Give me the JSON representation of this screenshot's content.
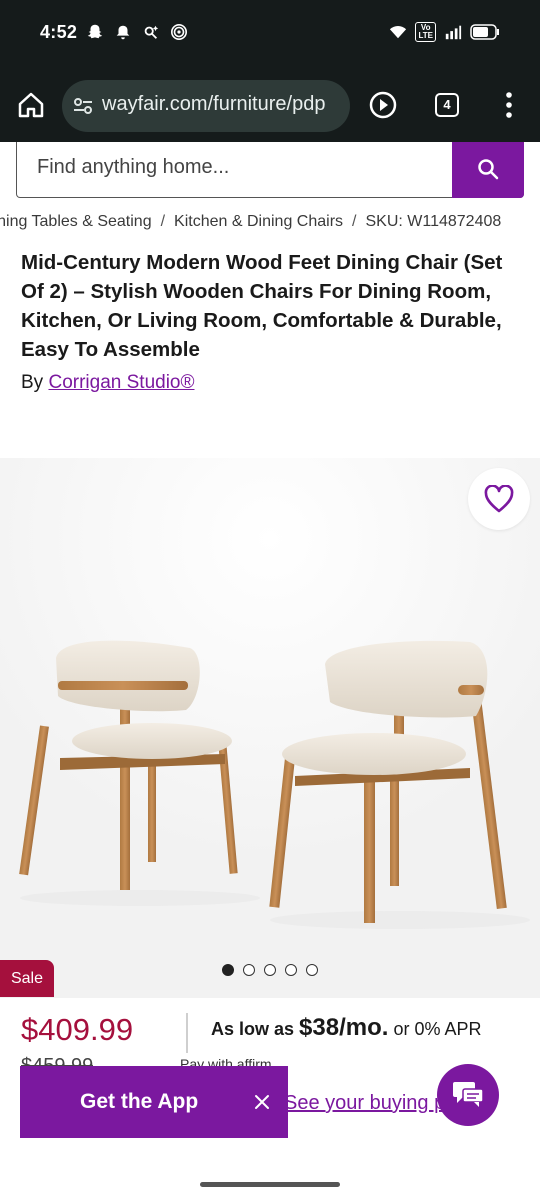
{
  "status_bar": {
    "time": "4:52",
    "network_badge_top": "Vo",
    "network_badge_bottom": "LTE",
    "icons": [
      "snapchat-icon",
      "bell-icon",
      "assistant-icon",
      "hotspot-icon",
      "wifi-icon",
      "signal-icon",
      "battery-icon"
    ]
  },
  "browser": {
    "url": "wayfair.com/furniture/pdp",
    "tab_count": "4"
  },
  "search": {
    "placeholder": "Find anything home..."
  },
  "breadcrumb": {
    "items": [
      "Dining Tables & Seating",
      "Kitchen & Dining Chairs",
      "SKU: W114872408"
    ],
    "separator": "/"
  },
  "product": {
    "title": "Mid-Century Modern Wood Feet Dining Chair (Set Of 2) – Stylish Wooden Chairs For Dining Room, Kitchen, Or Living Room, Comfortable & Durable, Easy To Assemble",
    "by_label": "By",
    "brand": "Corrigan Studio®",
    "sale_badge": "Sale",
    "price": "$409.99",
    "original_price": "$459.99",
    "financing": {
      "prefix": "As low as",
      "amount": "$38/mo.",
      "suffix": "or 0% APR"
    },
    "affirm_text": "Pay with affirm",
    "prequal_link": "See your buying power"
  },
  "gallery": {
    "image_count": 5,
    "active_index": 0
  },
  "get_app": {
    "label": "Get the App"
  },
  "colors": {
    "brand_purple": "#7b189f",
    "sale_red": "#a5103d",
    "chrome_dark": "#151b1b"
  }
}
